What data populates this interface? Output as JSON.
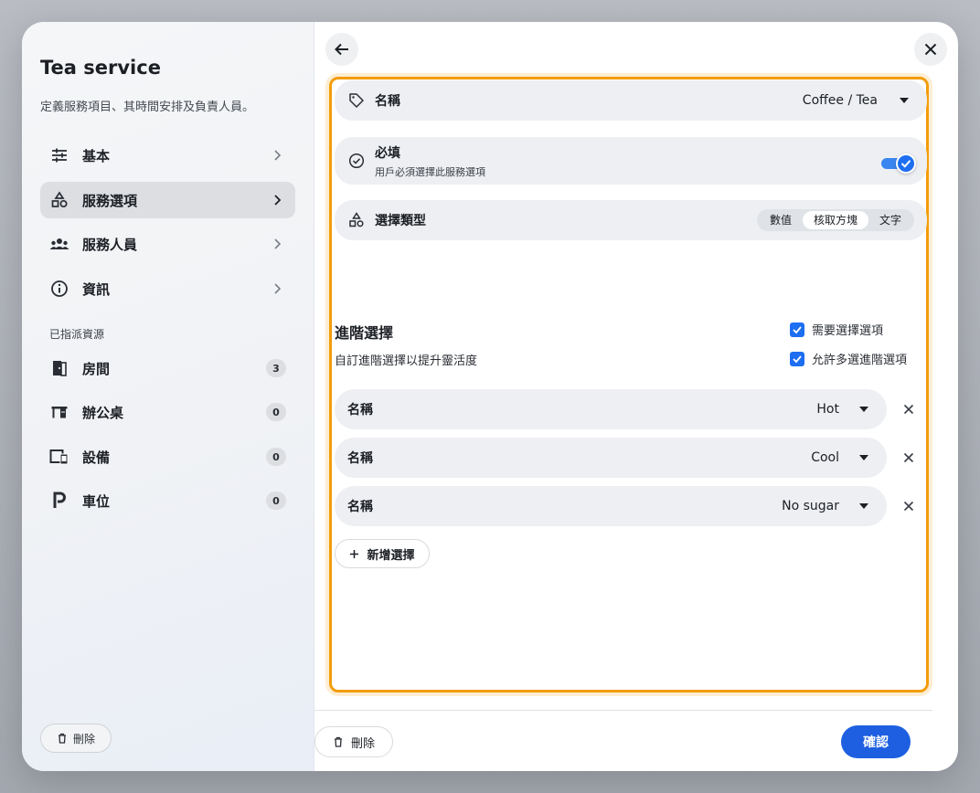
{
  "sidebar": {
    "title": "Tea service",
    "subtitle": "定義服務項目、其時間安排及負責人員。",
    "nav": [
      {
        "label": "基本"
      },
      {
        "label": "服務選項"
      },
      {
        "label": "服務人員"
      },
      {
        "label": "資訊"
      }
    ],
    "section_title": "已指派資源",
    "resources": [
      {
        "label": "房間",
        "count": "3"
      },
      {
        "label": "辦公桌",
        "count": "0"
      },
      {
        "label": "設備",
        "count": "0"
      },
      {
        "label": "車位",
        "count": "0"
      }
    ],
    "delete_label": "刪除"
  },
  "form": {
    "name": {
      "label": "名稱",
      "value": "Coffee / Tea"
    },
    "required": {
      "label": "必填",
      "description": "用戶必須選擇此服務選項",
      "enabled": true
    },
    "choice_type": {
      "label": "選擇類型",
      "options": [
        "數值",
        "核取方塊",
        "文字"
      ],
      "selected": "核取方塊"
    }
  },
  "advanced": {
    "title": "進階選擇",
    "subtitle": "自訂進階選擇以提升靈活度",
    "checkbox_required": "需要選擇選項",
    "checkbox_multi": "允許多選進階選項",
    "options": [
      {
        "label": "名稱",
        "value": "Hot"
      },
      {
        "label": "名稱",
        "value": "Cool"
      },
      {
        "label": "名稱",
        "value": "No sugar"
      }
    ],
    "add_label": "新增選擇"
  },
  "footer": {
    "delete_label": "刪除",
    "confirm_label": "確認"
  },
  "colors": {
    "accent": "#1d5fe0",
    "highlight": "#f29d0c"
  }
}
